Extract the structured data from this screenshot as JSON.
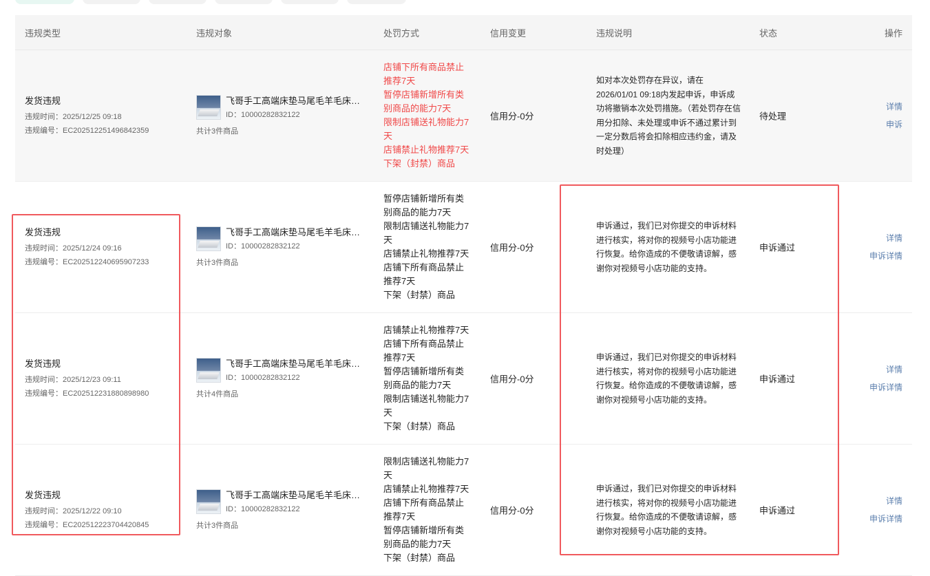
{
  "tabs": [
    "",
    "",
    "",
    "",
    "",
    ""
  ],
  "columns": {
    "type": "违规类型",
    "object": "违规对象",
    "penalty": "处罚方式",
    "credit": "信用变更",
    "desc": "违规说明",
    "status": "状态",
    "op": "操作"
  },
  "rows": [
    {
      "type": "发货违规",
      "time": "违规时间：2025/12/25 09:18",
      "code": "违规编号：EC202512251496842359",
      "product": "飞哥手工高端床垫马尾毛羊毛床垫席梦思乳胶床垫",
      "pid": "ID：10000282832122",
      "count": "共计3件商品",
      "penalty": [
        "店铺下所有商品禁止",
        "推荐7天",
        "暂停店铺新增所有类",
        "别商品的能力7天",
        "限制店铺送礼物能力7",
        "天",
        "店铺禁止礼物推荐7天",
        "下架（封禁）商品"
      ],
      "credit": "信用分-0分",
      "desc": "如对本次处罚存在异议，请在2026/01/01 09:18内发起申诉，申诉成功将撤销本次处罚措施。（若处罚存在信用分扣除、未处理或申诉不通过累计到一定分数后将会扣除相应违约金，请及时处理）",
      "status": "待处理",
      "ops": [
        "详情",
        "申诉"
      ]
    },
    {
      "type": "发货违规",
      "time": "违规时间：2025/12/24 09:16",
      "code": "违规编号：EC202512240695907233",
      "product": "飞哥手工高端床垫马尾毛羊毛床垫席梦思乳胶床垫",
      "pid": "ID：10000282832122",
      "count": "共计3件商品",
      "penalty": [
        "暂停店铺新增所有类",
        "别商品的能力7天",
        "限制店铺送礼物能力7",
        "天",
        "店铺禁止礼物推荐7天",
        "店铺下所有商品禁止",
        "推荐7天",
        "下架（封禁）商品"
      ],
      "credit": "信用分-0分",
      "desc": "申诉通过，我们已对你提交的申诉材料进行核实，将对你的视频号小店功能进行恢复。给你造成的不便敬请谅解，感谢你对视频号小店功能的支持。",
      "status": "申诉通过",
      "ops": [
        "详情",
        "申诉详情"
      ]
    },
    {
      "type": "发货违规",
      "time": "违规时间：2025/12/23 09:11",
      "code": "违规编号：EC202512231880898980",
      "product": "飞哥手工高端床垫马尾毛羊毛床垫席梦思乳胶床垫",
      "pid": "ID：10000282832122",
      "count": "共计4件商品",
      "penalty": [
        "店铺禁止礼物推荐7天",
        "店铺下所有商品禁止",
        "推荐7天",
        "暂停店铺新增所有类",
        "别商品的能力7天",
        "限制店铺送礼物能力7",
        "天",
        "下架（封禁）商品"
      ],
      "credit": "信用分-0分",
      "desc": "申诉通过，我们已对你提交的申诉材料进行核实，将对你的视频号小店功能进行恢复。给你造成的不便敬请谅解，感谢你对视频号小店功能的支持。",
      "status": "申诉通过",
      "ops": [
        "详情",
        "申诉详情"
      ]
    },
    {
      "type": "发货违规",
      "time": "违规时间：2025/12/22 09:10",
      "code": "违规编号：EC202512223704420845",
      "product": "飞哥手工高端床垫马尾毛羊毛床垫席梦思乳胶床垫",
      "pid": "ID：10000282832122",
      "count": "共计3件商品",
      "penalty": [
        "限制店铺送礼物能力7",
        "天",
        "店铺禁止礼物推荐7天",
        "店铺下所有商品禁止",
        "推荐7天",
        "暂停店铺新增所有类",
        "别商品的能力7天",
        "下架（封禁）商品"
      ],
      "credit": "信用分-0分",
      "desc": "申诉通过，我们已对你提交的申诉材料进行核实，将对你的视频号小店功能进行恢复。给你造成的不便敬请谅解，感谢你对视频号小店功能的支持。",
      "status": "申诉通过",
      "ops": [
        "详情",
        "申诉详情"
      ]
    }
  ],
  "colors": {
    "highlight": "#f0595d",
    "link": "#5c7fad",
    "penalty_red": "#f04848"
  }
}
